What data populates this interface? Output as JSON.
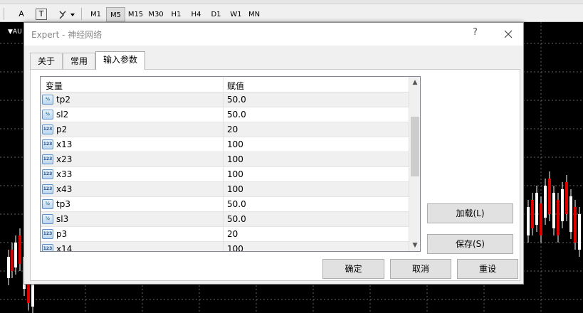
{
  "toolbar": {
    "items": [
      "A",
      "T"
    ],
    "timeframes": [
      "M1",
      "M5",
      "M15",
      "M30",
      "H1",
      "H4",
      "D1",
      "W1",
      "MN"
    ],
    "active_timeframe": "M5"
  },
  "chart": {
    "symbol_label": "AU"
  },
  "dialog": {
    "title": "Expert - 神经网络",
    "help": "?",
    "tabs": [
      "关于",
      "常用",
      "输入参数"
    ],
    "active_tab": "输入参数",
    "grid": {
      "columns": [
        "变量",
        "赋值"
      ],
      "rows": [
        {
          "icon": "double-type-icon",
          "icon_text": "½",
          "name": "tp2",
          "value": "50.0"
        },
        {
          "icon": "double-type-icon",
          "icon_text": "½",
          "name": "sl2",
          "value": "50.0"
        },
        {
          "icon": "int-type-icon",
          "icon_text": "123",
          "name": "p2",
          "value": "20"
        },
        {
          "icon": "int-type-icon",
          "icon_text": "123",
          "name": "x13",
          "value": "100"
        },
        {
          "icon": "int-type-icon",
          "icon_text": "123",
          "name": "x23",
          "value": "100"
        },
        {
          "icon": "int-type-icon",
          "icon_text": "123",
          "name": "x33",
          "value": "100"
        },
        {
          "icon": "int-type-icon",
          "icon_text": "123",
          "name": "x43",
          "value": "100"
        },
        {
          "icon": "double-type-icon",
          "icon_text": "½",
          "name": "tp3",
          "value": "50.0"
        },
        {
          "icon": "double-type-icon",
          "icon_text": "½",
          "name": "sl3",
          "value": "50.0"
        },
        {
          "icon": "int-type-icon",
          "icon_text": "123",
          "name": "p3",
          "value": "20"
        },
        {
          "icon": "int-type-icon",
          "icon_text": "123",
          "name": "x14",
          "value": "100"
        }
      ]
    },
    "buttons": {
      "load": "加载(L)",
      "save": "保存(S)",
      "ok": "确定",
      "cancel": "取消",
      "reset": "重设"
    }
  }
}
